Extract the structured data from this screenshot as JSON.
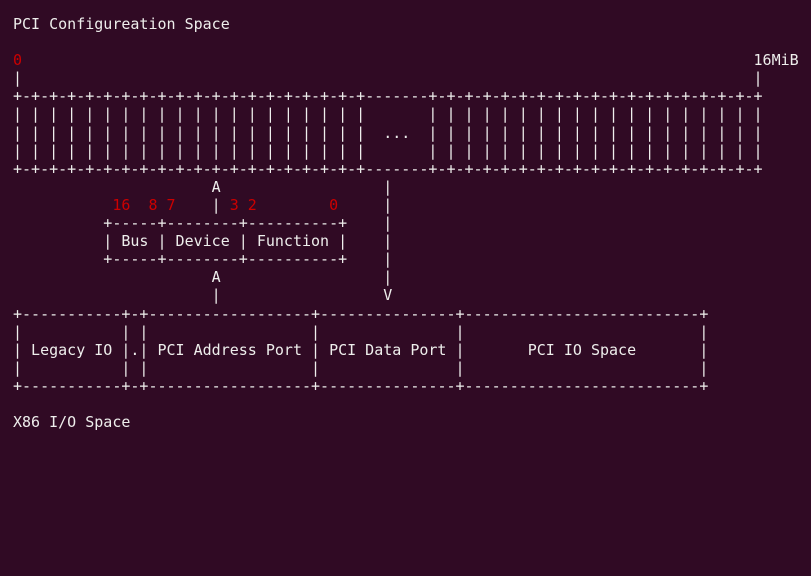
{
  "title": "PCI Configureation Space",
  "footer": "X86 I/O Space",
  "colors": {
    "background": "#300a24",
    "text": "#eeeeec",
    "bit_labels": "#cc0000"
  },
  "glyphs": {
    "bar": "|",
    "arrow_up": "A",
    "arrow_down": "V"
  },
  "config_space": {
    "start_label": "0",
    "end_label": "16MiB",
    "border_left": "+-+-+-+-+-+-+-+-+-+-+-+-+-+-+-+-+-+-+-+",
    "border_gap": "-------",
    "border_right": "+-+-+-+-+-+-+-+-+-+-+-+-+-+-+-+-+-+-+",
    "cells_left": "| | | | | | | | | | | | | | | | | | | |",
    "cells_right": "| | | | | | | | | | | | | | | | | | |",
    "ellipsis": "..."
  },
  "address_fields": {
    "bits": {
      "bus_high": "16",
      "bus_low": "8",
      "device_high": "7",
      "device_low": "3",
      "function_high": "2",
      "function_low": "0"
    },
    "border": "+-----+--------+----------+",
    "fields": [
      "Bus",
      "Device",
      "Function"
    ]
  },
  "io_space": {
    "border": "+-----------+-+------------------+---------------+--------------------------+",
    "regions": [
      "Legacy IO",
      ".",
      "PCI Address Port",
      "PCI Data Port",
      "PCI IO Space"
    ]
  }
}
